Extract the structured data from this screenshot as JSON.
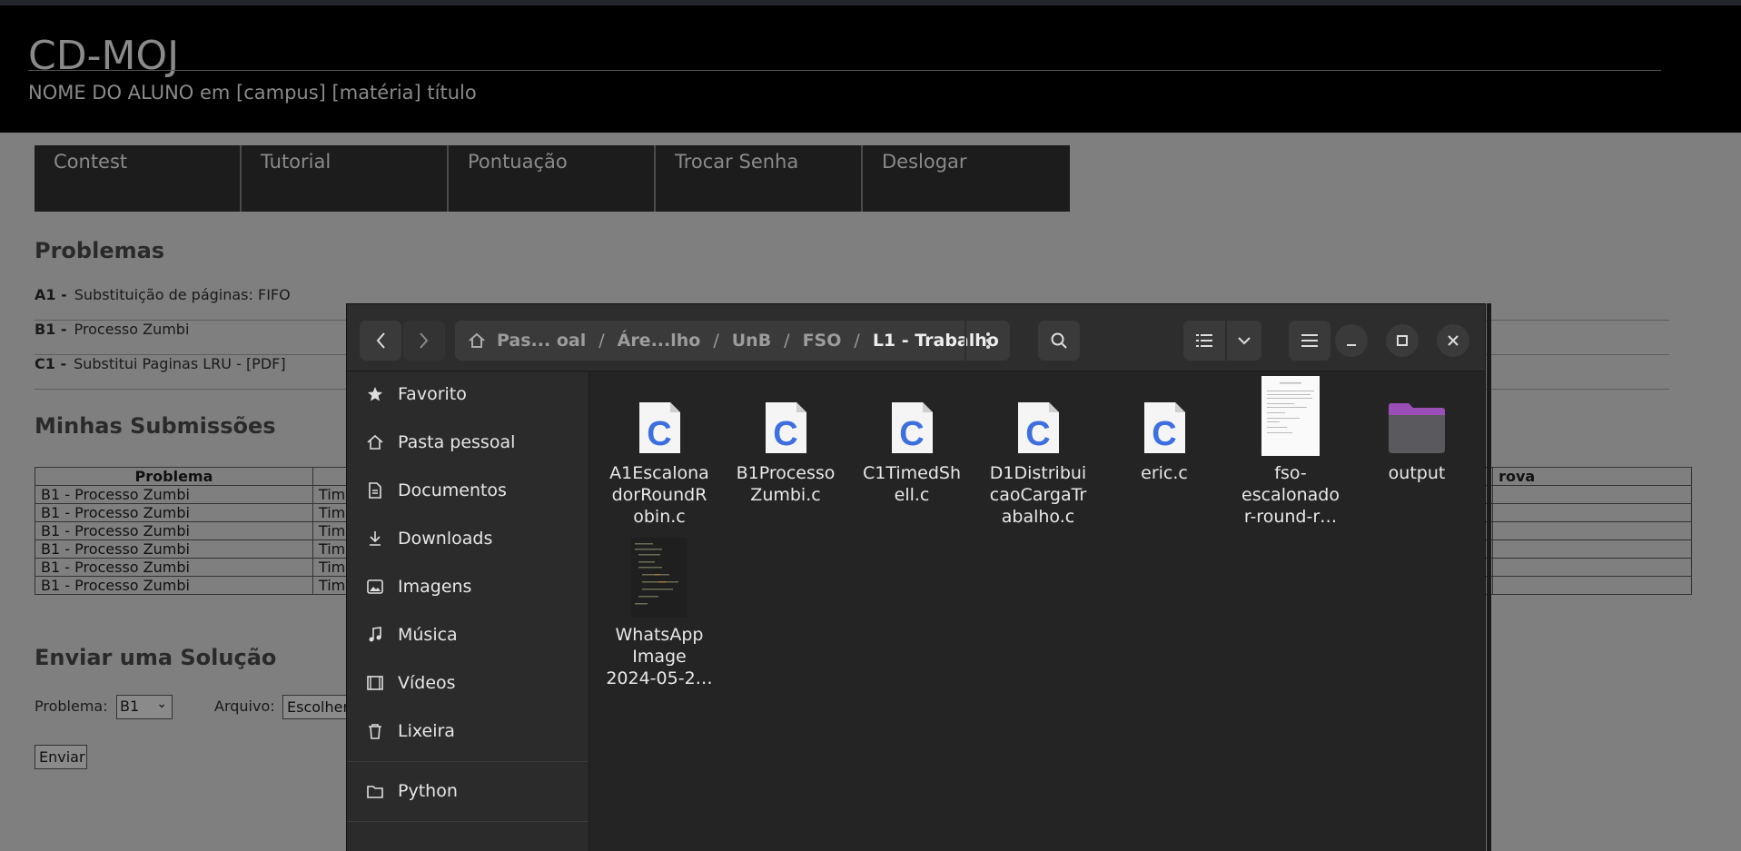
{
  "site": {
    "title": "CD-MOJ",
    "subtitle": "NOME DO ALUNO em [campus] [matéria] título"
  },
  "nav": [
    "Contest",
    "Tutorial",
    "Pontuação",
    "Trocar Senha",
    "Deslogar"
  ],
  "problems_heading": "Problemas",
  "problems": [
    {
      "code": "A1 -",
      "name": "Substituição de páginas: FIFO"
    },
    {
      "code": "B1 -",
      "name": "Processo Zumbi"
    },
    {
      "code": "C1 -",
      "name": "Substitui Paginas LRU - [PDF]"
    }
  ],
  "submissions_heading": "Minhas Submissões",
  "submissions_table": {
    "headers": [
      "Problema",
      "",
      "",
      "rova"
    ],
    "rows": [
      [
        "B1 - Processo Zumbi",
        "Tim",
        "",
        ""
      ],
      [
        "B1 - Processo Zumbi",
        "Tim",
        "",
        ""
      ],
      [
        "B1 - Processo Zumbi",
        "Tim",
        "",
        ""
      ],
      [
        "B1 - Processo Zumbi",
        "Tim",
        "",
        ""
      ],
      [
        "B1 - Processo Zumbi",
        "Tim",
        "",
        ""
      ],
      [
        "B1 - Processo Zumbi",
        "Tim",
        "",
        ""
      ]
    ]
  },
  "send_heading": "Enviar uma Solução",
  "form": {
    "problem_label": "Problema:",
    "problem_value": "B1",
    "file_label": "Arquivo:",
    "file_button": "Escolher",
    "send_button": "Enviar"
  },
  "dialog": {
    "breadcrumbs": [
      "Pas... oal",
      "Áre...lho",
      "UnB",
      "FSO",
      "L1 - Trabalho"
    ],
    "sidebar": [
      {
        "label": "Favorito",
        "icon": "star-icon"
      },
      {
        "label": "Pasta pessoal",
        "icon": "home-icon"
      },
      {
        "label": "Documentos",
        "icon": "document-icon"
      },
      {
        "label": "Downloads",
        "icon": "download-icon"
      },
      {
        "label": "Imagens",
        "icon": "image-icon"
      },
      {
        "label": "Música",
        "icon": "music-icon"
      },
      {
        "label": "Vídeos",
        "icon": "video-icon"
      },
      {
        "label": "Lixeira",
        "icon": "trash-icon"
      },
      {
        "label": "Python",
        "icon": "folder-icon"
      }
    ],
    "files": [
      {
        "name": "A1EscalonadorRoundRobin.c",
        "lines": [
          "A1Escalona",
          "dorRoundR",
          "obin.c"
        ],
        "icon": "c-file-icon"
      },
      {
        "name": "B1ProcessoZumbi.c",
        "lines": [
          "B1Processo",
          "Zumbi.c"
        ],
        "icon": "c-file-icon"
      },
      {
        "name": "C1TimedShell.c",
        "lines": [
          "C1TimedSh",
          "ell.c"
        ],
        "icon": "c-file-icon"
      },
      {
        "name": "D1DistribuicaoCargaTrabalho.c",
        "lines": [
          "D1Distribui",
          "caoCargaTr",
          "abalho.c"
        ],
        "icon": "c-file-icon"
      },
      {
        "name": "eric.c",
        "lines": [
          "eric.c"
        ],
        "icon": "c-file-icon"
      },
      {
        "name": "fso-escalonador-round-r…",
        "lines": [
          "fso-",
          "escalonado",
          "r-round-r…"
        ],
        "icon": "pdf-thumbnail-icon"
      },
      {
        "name": "output",
        "lines": [
          "output"
        ],
        "icon": "folder-icon"
      },
      {
        "name": "WhatsApp Image 2024-05-2…",
        "lines": [
          "WhatsApp",
          "Image",
          "2024-05-2…"
        ],
        "icon": "image-thumbnail-icon"
      }
    ],
    "colors": {
      "c_icon_letter": "#3d6fe0",
      "folder": "#9a4fb8"
    }
  }
}
